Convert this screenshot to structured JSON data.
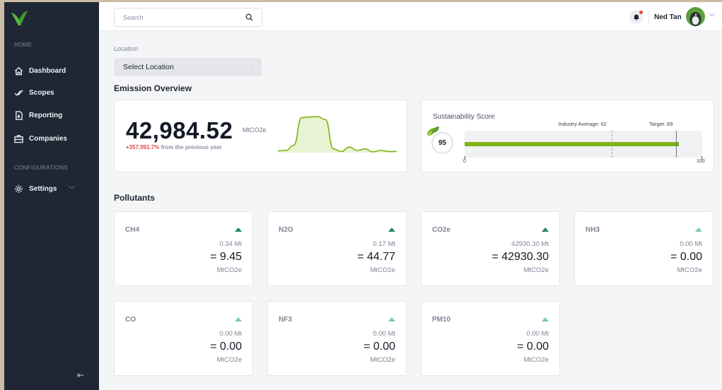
{
  "sidebar": {
    "sections": [
      "HOME",
      "CONFIGURATIONS"
    ],
    "items": [
      {
        "label": "Dashboard",
        "icon": "home-icon"
      },
      {
        "label": "Scopes",
        "icon": "check-icon"
      },
      {
        "label": "Reporting",
        "icon": "report-icon"
      },
      {
        "label": "Companies",
        "icon": "briefcase-icon"
      },
      {
        "label": "Settings",
        "icon": "gear-icon"
      }
    ],
    "collapse_icon": "collapse-icon"
  },
  "topbar": {
    "search_placeholder": "Search",
    "user_name": "Ned Tan"
  },
  "filters": {
    "location_label": "Location",
    "location_value": "Select Location"
  },
  "emission_overview": {
    "title": "Emission Overview",
    "total": "42,984.52",
    "unit": "MtCO2e",
    "change_value": "+357,991.7%",
    "change_text": "from the previous year",
    "sparkline": [
      0.05,
      0.06,
      0.2,
      0.95,
      0.97,
      0.98,
      0.9,
      0.1,
      0.03,
      0.15,
      0.06,
      0.1,
      0.02,
      0.06,
      0.03,
      0.03
    ]
  },
  "sustainability": {
    "title": "Sustainability Score",
    "score": "95",
    "score_value": 95,
    "industry_avg_label": "Industry Average: 62",
    "industry_avg_value": 62,
    "target_label": "Target: 89",
    "target_value": 89,
    "min_label": "0",
    "max_label": "100",
    "bar_color": "#7fb314"
  },
  "pollutants": {
    "title": "Pollutants",
    "items": [
      {
        "name": "CH4",
        "mt": "0.34 Mt",
        "value": "= 9.45",
        "unit": "MtCO2e",
        "trend": "up-dark"
      },
      {
        "name": "N2O",
        "mt": "0.17 Mt",
        "value": "= 44.77",
        "unit": "MtCO2e",
        "trend": "up-dark"
      },
      {
        "name": "CO2e",
        "mt": "42930.30 Mt",
        "value": "= 42930.30",
        "unit": "MtCO2e",
        "trend": "up-dark"
      },
      {
        "name": "NH3",
        "mt": "0.00 Mt",
        "value": "= 0.00",
        "unit": "MtCO2e",
        "trend": "up-light"
      },
      {
        "name": "CO",
        "mt": "0.00 Mt",
        "value": "= 0.00",
        "unit": "MtCO2e",
        "trend": "up-light"
      },
      {
        "name": "NF3",
        "mt": "0.00 Mt",
        "value": "= 0.00",
        "unit": "MtCO2e",
        "trend": "up-light"
      },
      {
        "name": "PM10",
        "mt": "0.00 Mt",
        "value": "= 0.00",
        "unit": "MtCO2e",
        "trend": "up-light"
      }
    ]
  }
}
